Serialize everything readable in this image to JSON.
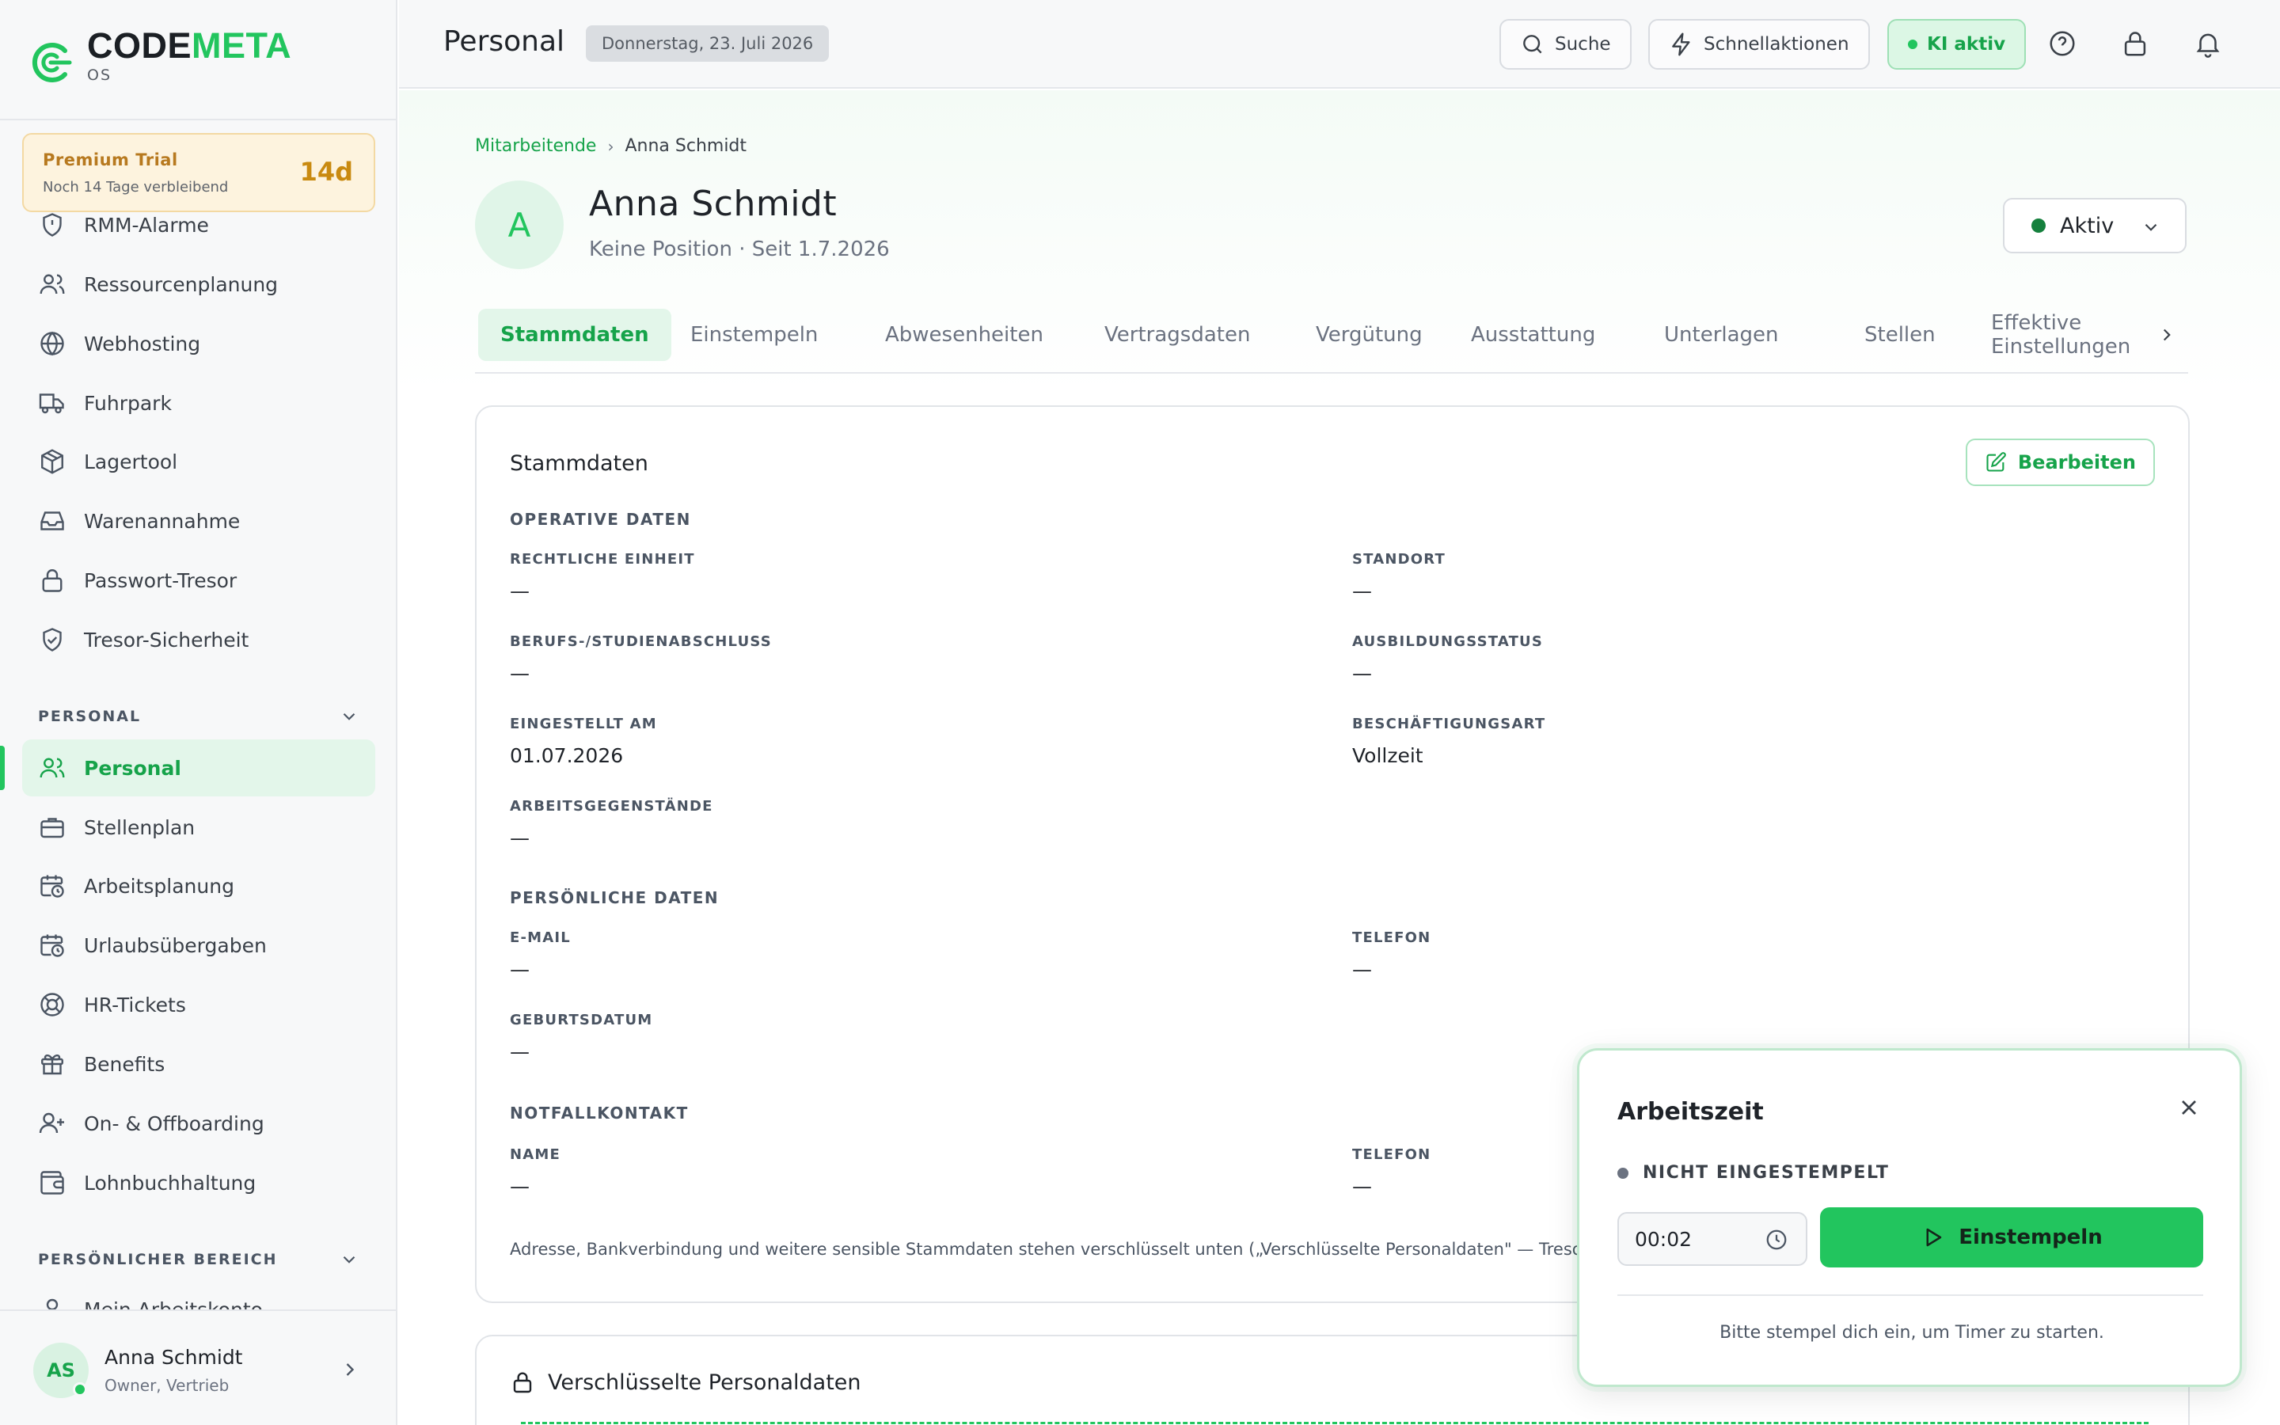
{
  "brand": {
    "name_part1": "CODE",
    "name_part2": "META",
    "sub": "OS",
    "accent": "#22c55e"
  },
  "trial": {
    "title": "Premium Trial",
    "subtitle": "Noch 14 Tage verbleibend",
    "days": "14d"
  },
  "sidebar": {
    "items": [
      {
        "label": "RMM-Alarme",
        "icon": "shield-alert-icon"
      },
      {
        "label": "Ressourcenplanung",
        "icon": "users-icon"
      },
      {
        "label": "Webhosting",
        "icon": "globe-icon"
      },
      {
        "label": "Fuhrpark",
        "icon": "truck-icon"
      },
      {
        "label": "Lagertool",
        "icon": "box-icon"
      },
      {
        "label": "Warenannahme",
        "icon": "inbox-icon"
      },
      {
        "label": "Passwort-Tresor",
        "icon": "lock-icon"
      },
      {
        "label": "Tresor-Sicherheit",
        "icon": "shield-check-icon"
      }
    ],
    "section_personal": "PERSONAL",
    "personal_items": [
      {
        "label": "Personal",
        "icon": "users-icon",
        "active": true
      },
      {
        "label": "Stellenplan",
        "icon": "briefcase-icon"
      },
      {
        "label": "Arbeitsplanung",
        "icon": "calendar-clock-icon"
      },
      {
        "label": "Urlaubsübergaben",
        "icon": "calendar-clock-icon"
      },
      {
        "label": "HR-Tickets",
        "icon": "lifebuoy-icon"
      },
      {
        "label": "Benefits",
        "icon": "gift-icon"
      },
      {
        "label": "On- & Offboarding",
        "icon": "user-plus-icon"
      },
      {
        "label": "Lohnbuchhaltung",
        "icon": "wallet-icon"
      }
    ],
    "section_private": "PERSÖNLICHER BEREICH",
    "private_items": [
      {
        "label": "Mein Arbeitskonto",
        "icon": "user-icon"
      }
    ]
  },
  "user": {
    "initials": "AS",
    "name": "Anna Schmidt",
    "role": "Owner, Vertrieb"
  },
  "header": {
    "title": "Personal",
    "date": "Donnerstag, 23. Juli 2026",
    "search_label": "Suche",
    "quick_label": "Schnellaktionen",
    "ki_label": "KI aktiv"
  },
  "breadcrumb": {
    "parent": "Mitarbeitende",
    "separator": "›",
    "current": "Anna Schmidt"
  },
  "employee": {
    "initial": "A",
    "name": "Anna Schmidt",
    "subtitle": "Keine Position · Seit 1.7.2026",
    "status": "Aktiv"
  },
  "tabs": [
    {
      "label": "Stammdaten",
      "active": true
    },
    {
      "label": "Einstempeln"
    },
    {
      "label": "Abwesenheiten"
    },
    {
      "label": "Vertragsdaten"
    },
    {
      "label": "Vergütung"
    },
    {
      "label": "Ausstattung"
    },
    {
      "label": "Unterlagen"
    },
    {
      "label": "Stellen"
    },
    {
      "label": "Effektive Einstellungen"
    }
  ],
  "stammdaten": {
    "title": "Stammdaten",
    "edit_label": "Bearbeiten",
    "operative": {
      "heading": "OPERATIVE DATEN",
      "fields": [
        {
          "label": "RECHTLICHE EINHEIT",
          "value": "—"
        },
        {
          "label": "STANDORT",
          "value": "—"
        },
        {
          "label": "BERUFS-/STUDIENABSCHLUSS",
          "value": "—"
        },
        {
          "label": "AUSBILDUNGSSTATUS",
          "value": "—"
        },
        {
          "label": "EINGESTELLT AM",
          "value": "01.07.2026"
        },
        {
          "label": "BESCHÄFTIGUNGSART",
          "value": "Vollzeit"
        },
        {
          "label": "ARBEITSGEGENSTÄNDE",
          "value": "—"
        }
      ]
    },
    "personal": {
      "heading": "PERSÖNLICHE DATEN",
      "fields": [
        {
          "label": "E-MAIL",
          "value": "—"
        },
        {
          "label": "TELEFON",
          "value": "—"
        },
        {
          "label": "GEBURTSDATUM",
          "value": "—"
        }
      ]
    },
    "emergency": {
      "heading": "NOTFALLKONTAKT",
      "fields": [
        {
          "label": "NAME",
          "value": "—"
        },
        {
          "label": "TELEFON",
          "value": "—"
        }
      ]
    },
    "note": "Adresse, Bankverbindung und weitere sensible Stammdaten stehen verschlüsselt unten („Verschlüsselte Personaldaten\" — Treso"
  },
  "encrypted": {
    "title": "Verschlüsselte Personaldaten"
  },
  "timer": {
    "title": "Arbeitszeit",
    "status": "NICHT EINGESTEMPELT",
    "time_value": "00:02",
    "start_label": "Einstempeln",
    "hint": "Bitte stempel dich ein, um Timer zu starten."
  }
}
